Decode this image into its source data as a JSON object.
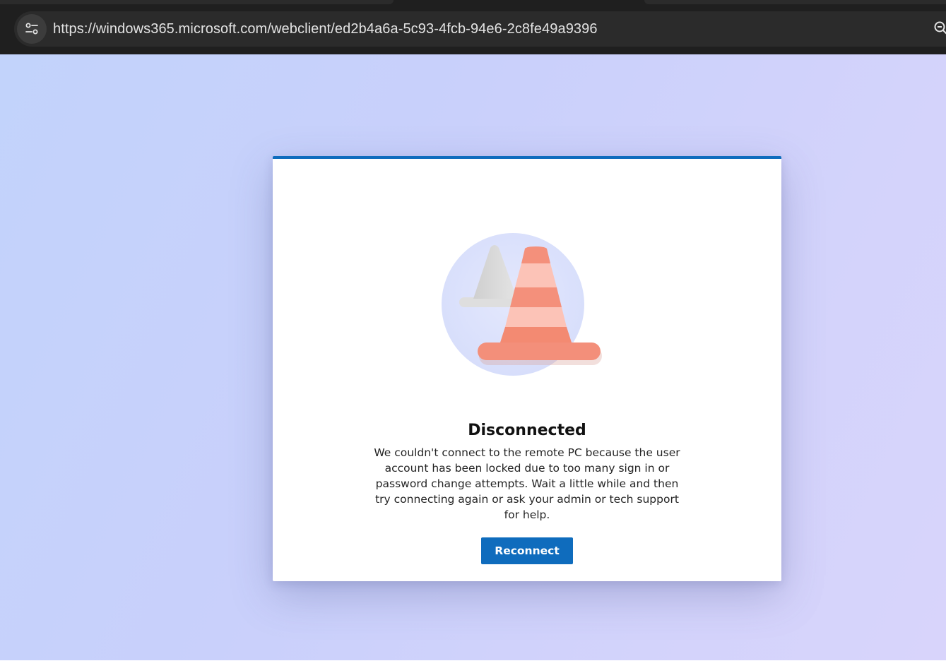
{
  "browser": {
    "url": "https://windows365.microsoft.com/webclient/ed2b4a6a-5c93-4fcb-94e6-2c8fe49a9396",
    "site_info_icon": "tune-icon",
    "zoom_icon": "zoom-icon"
  },
  "dialog": {
    "accent_color": "#0f6cbd",
    "illustration": "traffic-cones-icon",
    "title": "Disconnected",
    "message": "We couldn't connect to the remote PC because the user account has been locked due to too many sign in or password change attempts. Wait a little while and then try connecting again or ask your admin or tech support for help.",
    "reconnect_label": "Reconnect"
  }
}
